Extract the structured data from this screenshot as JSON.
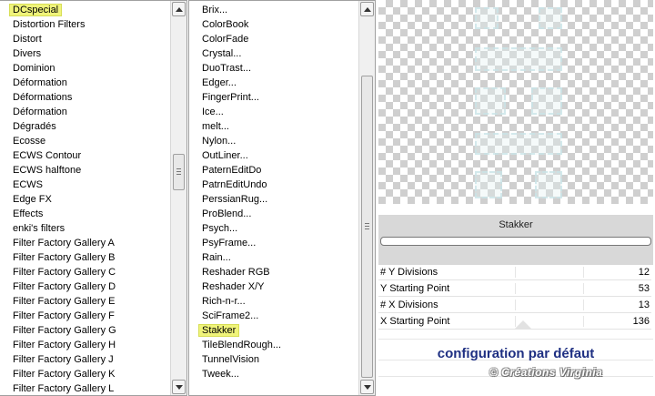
{
  "categories": {
    "items": [
      "DCspecial",
      "Distortion Filters",
      "Distort",
      "Divers",
      "Dominion",
      "Déformation",
      "Déformations",
      "Déformation",
      "Dégradés",
      "Ecosse",
      "ECWS Contour",
      "ECWS halftone",
      "ECWS",
      "Edge FX",
      "Effects",
      "enki's filters",
      "Filter Factory Gallery A",
      "Filter Factory Gallery B",
      "Filter Factory Gallery C",
      "Filter Factory Gallery D",
      "Filter Factory Gallery E",
      "Filter Factory Gallery F",
      "Filter Factory Gallery G",
      "Filter Factory Gallery H",
      "Filter Factory Gallery J",
      "Filter Factory Gallery K",
      "Filter Factory Gallery L"
    ],
    "selected_index": 0
  },
  "filters": {
    "items": [
      "Brix...",
      "ColorBook",
      "ColorFade",
      "Crystal...",
      "DuoTrast...",
      "Edger...",
      "FingerPrint...",
      "Ice...",
      "melt...",
      "Nylon...",
      "OutLiner...",
      "PaternEditDo",
      "PatrnEditUndo",
      "PerssianRug...",
      "ProBlend...",
      "Psych...",
      "PsyFrame...",
      "Rain...",
      "Reshader RGB",
      "Reshader X/Y",
      "Rich-n-r...",
      "SciFrame2...",
      "Stakker",
      "TileBlendRough...",
      "TunnelVision",
      "Tweek..."
    ],
    "selected_index": 22
  },
  "panel": {
    "filter_title": "Stakker",
    "params": [
      {
        "label": "# Y Divisions",
        "value": "12"
      },
      {
        "label": "Y Starting Point",
        "value": "53"
      },
      {
        "label": "# X Divisions",
        "value": "13"
      },
      {
        "label": "X Starting Point",
        "value": "136"
      }
    ],
    "config_label": "configuration par défaut",
    "watermark": "© Créations Virginia"
  },
  "colors": {
    "highlight": "#f0f47a",
    "config_text": "#1e2f82",
    "panel_gray": "#d8d8d8"
  },
  "icons": {
    "scroll_up": "triangle-up-icon",
    "scroll_down": "triangle-down-icon"
  }
}
